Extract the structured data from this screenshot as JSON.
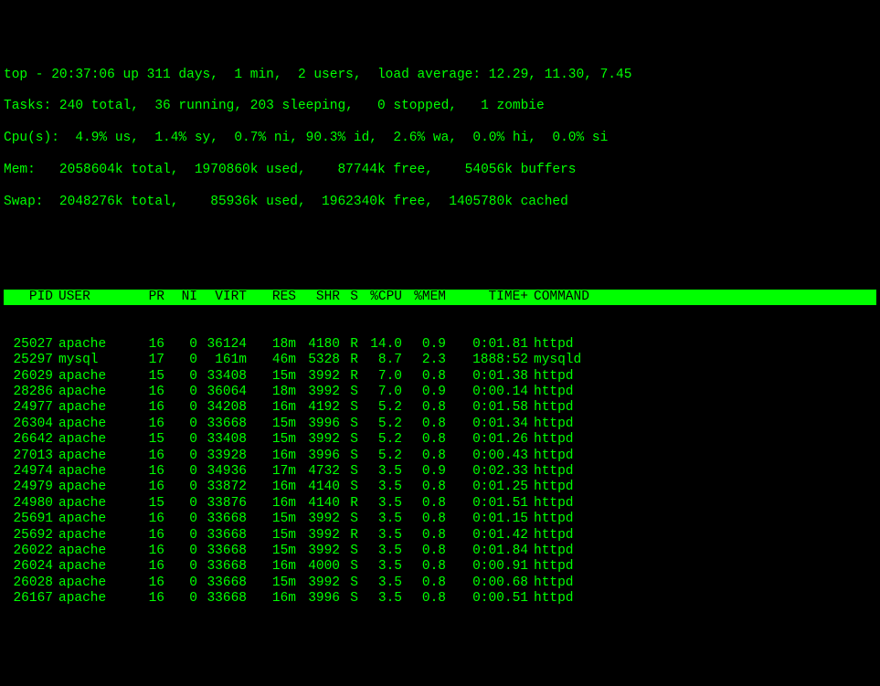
{
  "summary": {
    "line1": "top - 20:37:06 up 311 days,  1 min,  2 users,  load average: 12.29, 11.30, 7.45",
    "line2": "Tasks: 240 total,  36 running, 203 sleeping,   0 stopped,   1 zombie",
    "line3": "Cpu(s):  4.9% us,  1.4% sy,  0.7% ni, 90.3% id,  2.6% wa,  0.0% hi,  0.0% si",
    "line4": "Mem:   2058604k total,  1970860k used,    87744k free,    54056k buffers",
    "line5": "Swap:  2048276k total,    85936k used,  1962340k free,  1405780k cached"
  },
  "headers": {
    "pid": "PID",
    "user": "USER",
    "pr": "PR",
    "ni": "NI",
    "virt": "VIRT",
    "res": "RES",
    "shr": "SHR",
    "s": "S",
    "cpu": "%CPU",
    "mem": "%MEM",
    "time": "TIME+",
    "cmd": "COMMAND"
  },
  "processes": [
    {
      "pid": "25027",
      "user": "apache",
      "pr": "16",
      "ni": "0",
      "virt": "36124",
      "res": "18m",
      "shr": "4180",
      "s": "R",
      "cpu": "14.0",
      "mem": "0.9",
      "time": "0:01.81",
      "cmd": "httpd"
    },
    {
      "pid": "25297",
      "user": "mysql",
      "pr": "17",
      "ni": "0",
      "virt": "161m",
      "res": "46m",
      "shr": "5328",
      "s": "R",
      "cpu": "8.7",
      "mem": "2.3",
      "time": "1888:52",
      "cmd": "mysqld"
    },
    {
      "pid": "26029",
      "user": "apache",
      "pr": "15",
      "ni": "0",
      "virt": "33408",
      "res": "15m",
      "shr": "3992",
      "s": "R",
      "cpu": "7.0",
      "mem": "0.8",
      "time": "0:01.38",
      "cmd": "httpd"
    },
    {
      "pid": "28286",
      "user": "apache",
      "pr": "16",
      "ni": "0",
      "virt": "36064",
      "res": "18m",
      "shr": "3992",
      "s": "S",
      "cpu": "7.0",
      "mem": "0.9",
      "time": "0:00.14",
      "cmd": "httpd"
    },
    {
      "pid": "24977",
      "user": "apache",
      "pr": "16",
      "ni": "0",
      "virt": "34208",
      "res": "16m",
      "shr": "4192",
      "s": "S",
      "cpu": "5.2",
      "mem": "0.8",
      "time": "0:01.58",
      "cmd": "httpd"
    },
    {
      "pid": "26304",
      "user": "apache",
      "pr": "16",
      "ni": "0",
      "virt": "33668",
      "res": "15m",
      "shr": "3996",
      "s": "S",
      "cpu": "5.2",
      "mem": "0.8",
      "time": "0:01.34",
      "cmd": "httpd"
    },
    {
      "pid": "26642",
      "user": "apache",
      "pr": "15",
      "ni": "0",
      "virt": "33408",
      "res": "15m",
      "shr": "3992",
      "s": "S",
      "cpu": "5.2",
      "mem": "0.8",
      "time": "0:01.26",
      "cmd": "httpd"
    },
    {
      "pid": "27013",
      "user": "apache",
      "pr": "16",
      "ni": "0",
      "virt": "33928",
      "res": "16m",
      "shr": "3996",
      "s": "S",
      "cpu": "5.2",
      "mem": "0.8",
      "time": "0:00.43",
      "cmd": "httpd"
    },
    {
      "pid": "24974",
      "user": "apache",
      "pr": "16",
      "ni": "0",
      "virt": "34936",
      "res": "17m",
      "shr": "4732",
      "s": "S",
      "cpu": "3.5",
      "mem": "0.9",
      "time": "0:02.33",
      "cmd": "httpd"
    },
    {
      "pid": "24979",
      "user": "apache",
      "pr": "16",
      "ni": "0",
      "virt": "33872",
      "res": "16m",
      "shr": "4140",
      "s": "S",
      "cpu": "3.5",
      "mem": "0.8",
      "time": "0:01.25",
      "cmd": "httpd"
    },
    {
      "pid": "24980",
      "user": "apache",
      "pr": "15",
      "ni": "0",
      "virt": "33876",
      "res": "16m",
      "shr": "4140",
      "s": "R",
      "cpu": "3.5",
      "mem": "0.8",
      "time": "0:01.51",
      "cmd": "httpd"
    },
    {
      "pid": "25691",
      "user": "apache",
      "pr": "16",
      "ni": "0",
      "virt": "33668",
      "res": "15m",
      "shr": "3992",
      "s": "S",
      "cpu": "3.5",
      "mem": "0.8",
      "time": "0:01.15",
      "cmd": "httpd"
    },
    {
      "pid": "25692",
      "user": "apache",
      "pr": "16",
      "ni": "0",
      "virt": "33668",
      "res": "15m",
      "shr": "3992",
      "s": "R",
      "cpu": "3.5",
      "mem": "0.8",
      "time": "0:01.42",
      "cmd": "httpd"
    },
    {
      "pid": "26022",
      "user": "apache",
      "pr": "16",
      "ni": "0",
      "virt": "33668",
      "res": "15m",
      "shr": "3992",
      "s": "S",
      "cpu": "3.5",
      "mem": "0.8",
      "time": "0:01.84",
      "cmd": "httpd"
    },
    {
      "pid": "26024",
      "user": "apache",
      "pr": "16",
      "ni": "0",
      "virt": "33668",
      "res": "16m",
      "shr": "4000",
      "s": "S",
      "cpu": "3.5",
      "mem": "0.8",
      "time": "0:00.91",
      "cmd": "httpd"
    },
    {
      "pid": "26028",
      "user": "apache",
      "pr": "16",
      "ni": "0",
      "virt": "33668",
      "res": "15m",
      "shr": "3992",
      "s": "S",
      "cpu": "3.5",
      "mem": "0.8",
      "time": "0:00.68",
      "cmd": "httpd"
    },
    {
      "pid": "26167",
      "user": "apache",
      "pr": "16",
      "ni": "0",
      "virt": "33668",
      "res": "16m",
      "shr": "3996",
      "s": "S",
      "cpu": "3.5",
      "mem": "0.8",
      "time": "0:00.51",
      "cmd": "httpd"
    }
  ]
}
